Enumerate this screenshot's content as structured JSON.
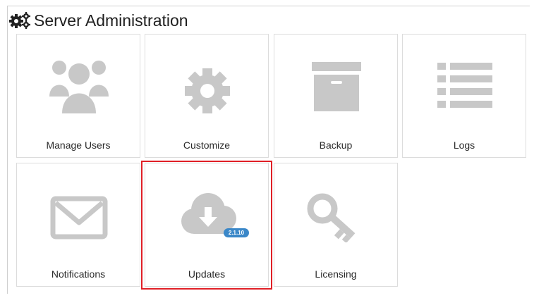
{
  "header": {
    "title": "Server Administration",
    "icon": "gears-icon"
  },
  "tiles": [
    {
      "label": "Manage Users",
      "icon": "users-icon"
    },
    {
      "label": "Customize",
      "icon": "gear-icon"
    },
    {
      "label": "Backup",
      "icon": "archive-box-icon"
    },
    {
      "label": "Logs",
      "icon": "list-icon"
    },
    {
      "label": "Notifications",
      "icon": "envelope-icon"
    },
    {
      "label": "Updates",
      "icon": "cloud-download-icon",
      "badge": "2.1.10",
      "highlighted": true
    },
    {
      "label": "Licensing",
      "icon": "key-icon"
    }
  ],
  "colors": {
    "icon_gray": "#c8c8c8",
    "badge_blue": "#3a87c8",
    "highlight_red": "#e01f26",
    "tile_border": "#dcdcdc"
  }
}
